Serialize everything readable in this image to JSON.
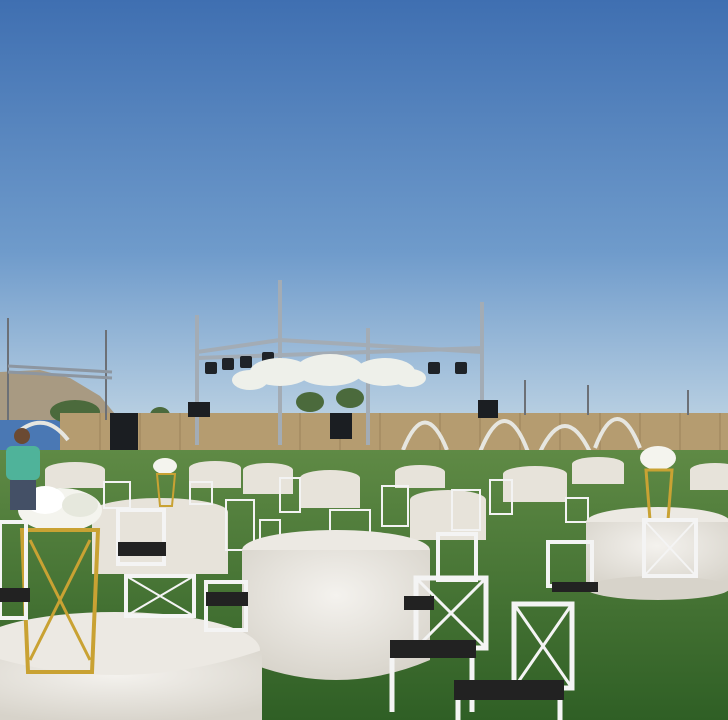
{
  "scene": {
    "label": "",
    "colors": {
      "sky_top": "#3f6fb1",
      "sky_bottom": "#a9c6df",
      "grass": "#3e7a2f",
      "grass_dark": "#2f5f25",
      "tablecloth": "#ece9e3",
      "chair": "#f2f2f2",
      "chair_seat": "#222222",
      "fence": "#b59c70",
      "truss": "#9aa3ac",
      "gold": "#c9a233",
      "flowers": "#f4f4ee"
    }
  }
}
